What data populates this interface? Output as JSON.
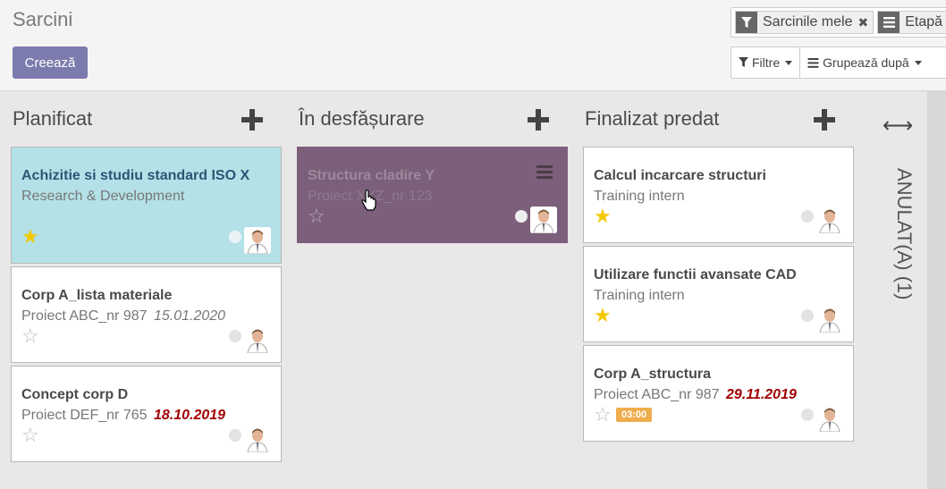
{
  "page": {
    "title": "Sarcini",
    "create_label": "Creează"
  },
  "search": {
    "facets": [
      {
        "icon": "filter-icon",
        "label": "Sarcinile mele"
      },
      {
        "icon": "list-icon",
        "label": "Etapă"
      }
    ],
    "filters_label": "Filtre",
    "group_by_label": "Grupează după"
  },
  "columns": [
    {
      "title": "Planificat",
      "cards": [
        {
          "title": "Achizitie si studiu standard ISO X",
          "subtitle": "Research & Development",
          "date": "",
          "starred": true
        },
        {
          "title": "Corp A_lista materiale",
          "subtitle": "Proiect ABC_nr 987",
          "date": "15.01.2020",
          "starred": false
        },
        {
          "title": "Concept corp D",
          "subtitle": "Proiect DEF_nr 765",
          "date": "18.10.2019",
          "starred": false
        }
      ]
    },
    {
      "title": "În desfășurare",
      "cards": [
        {
          "title": "Structura cladire Y",
          "subtitle": "Proiect XYZ_nr 123",
          "date": "",
          "starred": false
        }
      ]
    },
    {
      "title": "Finalizat predat",
      "cards": [
        {
          "title": "Calcul incarcare structuri",
          "subtitle": "Training intern",
          "date": "",
          "starred": true
        },
        {
          "title": "Utilizare functii avansate CAD",
          "subtitle": "Training intern",
          "date": "",
          "starred": true
        },
        {
          "title": "Corp A_structura",
          "subtitle": "Proiect ABC_nr 987",
          "date": "29.11.2019",
          "starred": false,
          "badge": "03:00"
        }
      ]
    }
  ],
  "folded_column": {
    "title": "ANULAT(A) (1)"
  },
  "colors": {
    "primary": "#7c7bad",
    "highlight": "#b4e1e7",
    "dragging": "#7c5f7a",
    "star": "#f3c800",
    "overdue": "#a10000",
    "badge": "#f0ad4e"
  }
}
